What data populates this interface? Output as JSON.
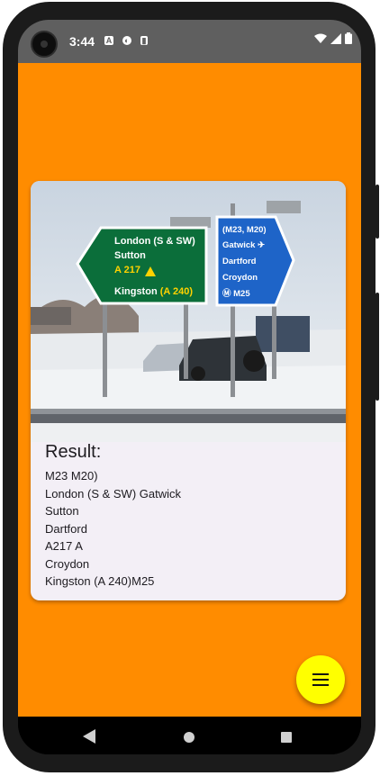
{
  "status_bar": {
    "time": "3:44",
    "notification_icons": [
      "font-icon",
      "sync-icon",
      "sd-card-icon"
    ],
    "system_icons": [
      "wifi-icon",
      "signal-icon",
      "battery-icon"
    ]
  },
  "app": {
    "background_color": "#ff8c00",
    "result_card": {
      "image": {
        "description_icon": "road-sign-photo",
        "green_sign_lines": [
          "London (S & SW)",
          "Sutton",
          "A 217",
          "Kingston (A 240)"
        ],
        "blue_sign_lines": [
          "(M23, M20)",
          "Gatwick",
          "Dartford",
          "Croydon",
          "M25"
        ]
      },
      "title": "Result:",
      "lines": [
        "M23 M20)",
        "London (S & SW) Gatwick",
        "Sutton",
        "Dartford",
        "A217 A",
        "Croydon",
        "Kingston (A 240)M25"
      ]
    },
    "fab": {
      "icon": "menu-icon",
      "color": "#ffff00"
    }
  },
  "nav_bar": {
    "icons": [
      "back-icon",
      "home-icon",
      "recents-icon"
    ]
  }
}
